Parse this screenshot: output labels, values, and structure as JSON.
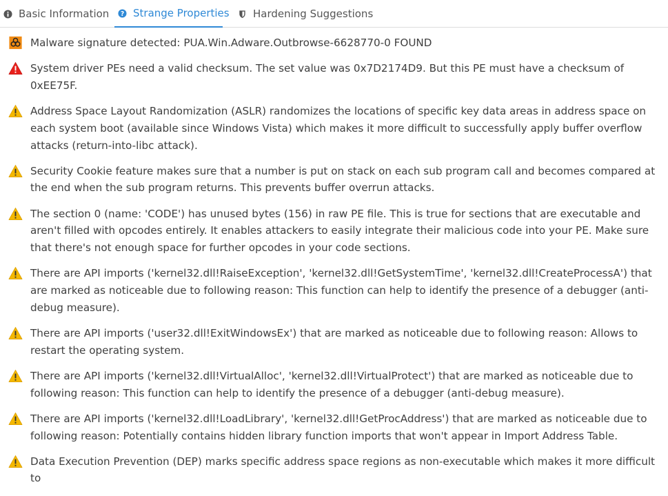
{
  "tabs": [
    {
      "label": "Basic Information",
      "icon": "info-circle-icon"
    },
    {
      "label": "Strange Properties",
      "icon": "question-circle-icon",
      "active": true
    },
    {
      "label": "Hardening Suggestions",
      "icon": "shield-icon"
    }
  ],
  "colors": {
    "accent": "#2f89d6",
    "warning_yellow": "#f5b800",
    "error_red": "#e8201c",
    "malware_orange": "#f08a12"
  },
  "items": [
    {
      "severity": "malware",
      "icon": "biohazard-icon",
      "text": "Malware signature detected: PUA.Win.Adware.Outbrowse-6628770-0 FOUND"
    },
    {
      "severity": "error",
      "icon": "error-triangle-icon",
      "text": "System driver PEs need a valid checksum. The set value was 0x7D2174D9. But this PE must have a checksum of 0xEE75F."
    },
    {
      "severity": "warning",
      "icon": "warning-triangle-icon",
      "text": "Address Space Layout Randomization (ASLR) randomizes the locations of specific key data areas in address space on each system boot (available since Windows Vista) which makes it more difficult to successfully apply buffer overflow attacks (return-into-libc attack)."
    },
    {
      "severity": "warning",
      "icon": "warning-triangle-icon",
      "text": "Security Cookie feature makes sure that a number is put on stack on each sub program call and becomes compared at the end when the sub program returns. This prevents buffer overrun attacks."
    },
    {
      "severity": "warning",
      "icon": "warning-triangle-icon",
      "text": "The section 0 (name: 'CODE') has unused bytes (156) in raw PE file. This is true for sections that are executable and aren't filled with opcodes entirely. It enables attackers to easily integrate their malicious code into your PE. Make sure that there's not enough space for further opcodes in your code sections."
    },
    {
      "severity": "warning",
      "icon": "warning-triangle-icon",
      "text": "There are API imports ('kernel32.dll!RaiseException', 'kernel32.dll!GetSystemTime', 'kernel32.dll!CreateProcessA') that are marked as noticeable due to following reason: This function can help to identify the presence of a debugger (anti-debug measure)."
    },
    {
      "severity": "warning",
      "icon": "warning-triangle-icon",
      "text": "There are API imports ('user32.dll!ExitWindowsEx') that are marked as noticeable due to following reason: Allows to restart the operating system."
    },
    {
      "severity": "warning",
      "icon": "warning-triangle-icon",
      "text": "There are API imports ('kernel32.dll!VirtualAlloc', 'kernel32.dll!VirtualProtect') that are marked as noticeable due to following reason: This function can help to identify the presence of a debugger (anti-debug measure)."
    },
    {
      "severity": "warning",
      "icon": "warning-triangle-icon",
      "text": "There are API imports ('kernel32.dll!LoadLibrary', 'kernel32.dll!GetProcAddress') that are marked as noticeable due to following reason: Potentially contains hidden library function imports that won't appear in Import Address Table."
    },
    {
      "severity": "warning",
      "icon": "warning-triangle-icon",
      "text": "Data Execution Prevention (DEP) marks specific address space regions as non-executable which makes it more difficult to"
    }
  ]
}
